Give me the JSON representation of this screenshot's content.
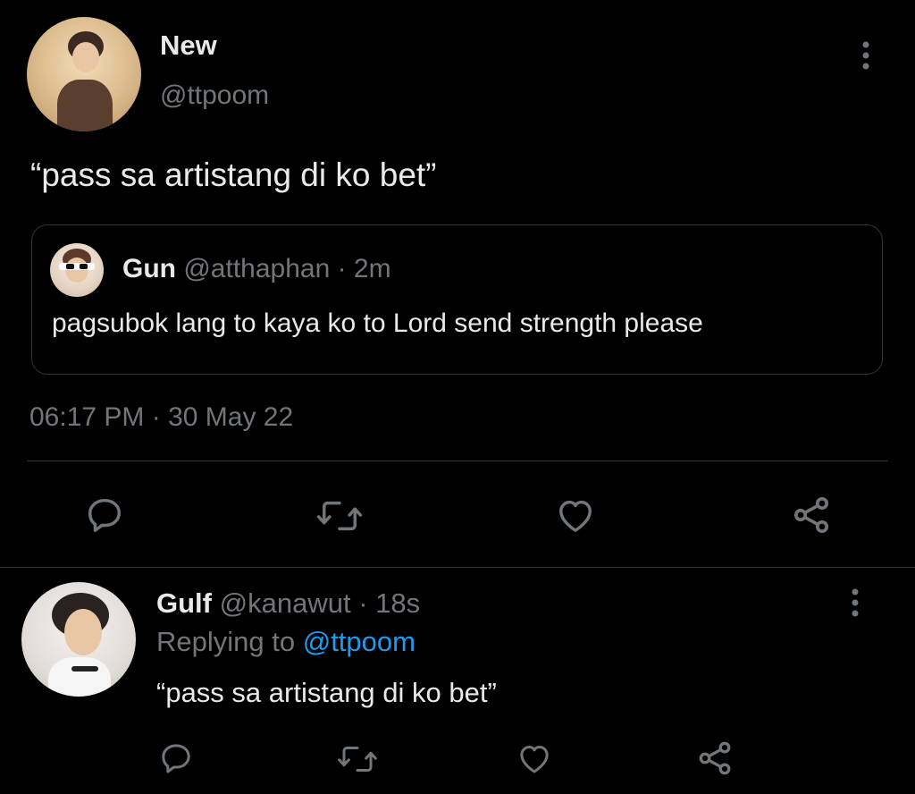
{
  "main_tweet": {
    "author_name": "New",
    "author_handle": "@ttpoom",
    "text": "“pass sa artistang di ko bet”",
    "timestamp": "06:17 PM · 30 May 22",
    "quoted": {
      "author_name": "Gun",
      "author_handle": "@atthaphan",
      "time": "· 2m",
      "text": "pagsubok lang to kaya ko to Lord send strength please"
    },
    "actions": [
      "reply",
      "retweet",
      "like",
      "share"
    ]
  },
  "reply": {
    "author_name": "Gulf",
    "author_handle": "@kanawut",
    "time": "· 18s",
    "replying_prefix": "Replying to",
    "replying_to": "@ttpoom",
    "text": "“pass sa artistang di ko bet”"
  },
  "colors": {
    "background": "#000000",
    "text": "#e7e9ea",
    "muted": "#71767b",
    "accent": "#1d9bf0",
    "border": "#2f3336"
  }
}
